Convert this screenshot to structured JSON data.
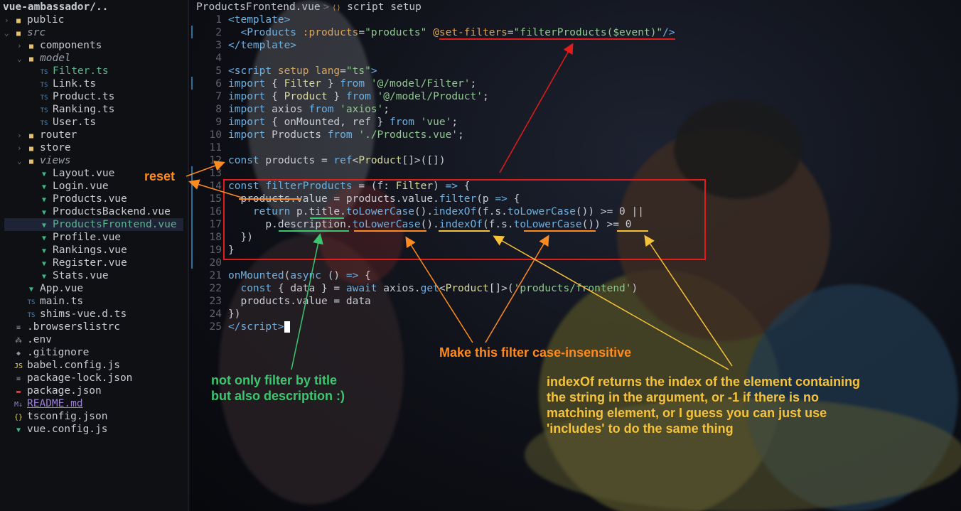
{
  "sidebar": {
    "root": "vue-ambassador/..",
    "items": [
      {
        "label": "public",
        "icon": "folder-icon",
        "depth": 0,
        "arrow": "›",
        "cls": "txt",
        "ic": "ic-folder",
        "glyph": "■"
      },
      {
        "label": "src",
        "icon": "folder-icon",
        "depth": 0,
        "arrow": "⌄",
        "cls": "lbl-muted",
        "ic": "ic-folder",
        "glyph": "■"
      },
      {
        "label": "components",
        "icon": "folder-icon",
        "depth": 1,
        "arrow": "›",
        "cls": "txt",
        "ic": "ic-folder",
        "glyph": "■"
      },
      {
        "label": "model",
        "icon": "folder-icon",
        "depth": 1,
        "arrow": "⌄",
        "cls": "lbl-muted",
        "ic": "ic-folder",
        "glyph": "■"
      },
      {
        "label": "Filter.ts",
        "icon": "typescript-file-icon",
        "depth": 2,
        "arrow": "",
        "cls": "lbl-green",
        "ic": "ic-ts",
        "glyph": "TS"
      },
      {
        "label": "Link.ts",
        "icon": "typescript-file-icon",
        "depth": 2,
        "arrow": "",
        "cls": "txt",
        "ic": "ic-ts",
        "glyph": "TS"
      },
      {
        "label": "Product.ts",
        "icon": "typescript-file-icon",
        "depth": 2,
        "arrow": "",
        "cls": "txt",
        "ic": "ic-ts",
        "glyph": "TS"
      },
      {
        "label": "Ranking.ts",
        "icon": "typescript-file-icon",
        "depth": 2,
        "arrow": "",
        "cls": "txt",
        "ic": "ic-ts",
        "glyph": "TS"
      },
      {
        "label": "User.ts",
        "icon": "typescript-file-icon",
        "depth": 2,
        "arrow": "",
        "cls": "txt",
        "ic": "ic-ts",
        "glyph": "TS"
      },
      {
        "label": "router",
        "icon": "folder-icon",
        "depth": 1,
        "arrow": "›",
        "cls": "txt",
        "ic": "ic-folder",
        "glyph": "■"
      },
      {
        "label": "store",
        "icon": "folder-icon",
        "depth": 1,
        "arrow": "›",
        "cls": "txt",
        "ic": "ic-folder",
        "glyph": "■"
      },
      {
        "label": "views",
        "icon": "folder-icon",
        "depth": 1,
        "arrow": "⌄",
        "cls": "lbl-muted",
        "ic": "ic-folder",
        "glyph": "■"
      },
      {
        "label": "Layout.vue",
        "icon": "vue-file-icon",
        "depth": 2,
        "arrow": "",
        "cls": "txt",
        "ic": "ic-vue",
        "glyph": "▼"
      },
      {
        "label": "Login.vue",
        "icon": "vue-file-icon",
        "depth": 2,
        "arrow": "",
        "cls": "txt",
        "ic": "ic-vue",
        "glyph": "▼"
      },
      {
        "label": "Products.vue",
        "icon": "vue-file-icon",
        "depth": 2,
        "arrow": "",
        "cls": "txt",
        "ic": "ic-vue",
        "glyph": "▼"
      },
      {
        "label": "ProductsBackend.vue",
        "icon": "vue-file-icon",
        "depth": 2,
        "arrow": "",
        "cls": "txt",
        "ic": "ic-vue",
        "glyph": "▼"
      },
      {
        "label": "ProductsFrontend.vue",
        "icon": "vue-file-icon",
        "depth": 2,
        "arrow": "",
        "cls": "lbl-green",
        "ic": "ic-vue",
        "glyph": "▼",
        "selected": true
      },
      {
        "label": "Profile.vue",
        "icon": "vue-file-icon",
        "depth": 2,
        "arrow": "",
        "cls": "txt",
        "ic": "ic-vue",
        "glyph": "▼"
      },
      {
        "label": "Rankings.vue",
        "icon": "vue-file-icon",
        "depth": 2,
        "arrow": "",
        "cls": "txt",
        "ic": "ic-vue",
        "glyph": "▼"
      },
      {
        "label": "Register.vue",
        "icon": "vue-file-icon",
        "depth": 2,
        "arrow": "",
        "cls": "txt",
        "ic": "ic-vue",
        "glyph": "▼"
      },
      {
        "label": "Stats.vue",
        "icon": "vue-file-icon",
        "depth": 2,
        "arrow": "",
        "cls": "txt",
        "ic": "ic-vue",
        "glyph": "▼"
      },
      {
        "label": "App.vue",
        "icon": "vue-file-icon",
        "depth": 1,
        "arrow": "",
        "cls": "txt",
        "ic": "ic-vue",
        "glyph": "▼"
      },
      {
        "label": "main.ts",
        "icon": "typescript-file-icon",
        "depth": 1,
        "arrow": "",
        "cls": "txt",
        "ic": "ic-ts",
        "glyph": "TS"
      },
      {
        "label": "shims-vue.d.ts",
        "icon": "typescript-file-icon",
        "depth": 1,
        "arrow": "",
        "cls": "txt",
        "ic": "ic-ts",
        "glyph": "TS"
      },
      {
        "label": ".browserslistrc",
        "icon": "config-file-icon",
        "depth": 0,
        "arrow": "",
        "cls": "txt",
        "ic": "ic-gen",
        "glyph": "≡"
      },
      {
        "label": ".env",
        "icon": "env-file-icon",
        "depth": 0,
        "arrow": "",
        "cls": "txt",
        "ic": "ic-gen",
        "glyph": "⁂"
      },
      {
        "label": ".gitignore",
        "icon": "git-file-icon",
        "depth": 0,
        "arrow": "",
        "cls": "txt",
        "ic": "ic-gen",
        "glyph": "◆"
      },
      {
        "label": "babel.config.js",
        "icon": "javascript-file-icon",
        "depth": 0,
        "arrow": "",
        "cls": "txt",
        "ic": "ic-js",
        "glyph": "JS"
      },
      {
        "label": "package-lock.json",
        "icon": "json-file-icon",
        "depth": 0,
        "arrow": "",
        "cls": "txt",
        "ic": "ic-gen",
        "glyph": "≡"
      },
      {
        "label": "package.json",
        "icon": "npm-file-icon",
        "depth": 0,
        "arrow": "",
        "cls": "txt",
        "ic": "ic-pkg",
        "glyph": "▬"
      },
      {
        "label": "README.md",
        "icon": "markdown-file-icon",
        "depth": 0,
        "arrow": "",
        "cls": "readme",
        "ic": "ic-md",
        "glyph": "M↓"
      },
      {
        "label": "tsconfig.json",
        "icon": "json-file-icon",
        "depth": 0,
        "arrow": "",
        "cls": "txt",
        "ic": "ic-json",
        "glyph": "{}"
      },
      {
        "label": "vue.config.js",
        "icon": "vue-file-icon",
        "depth": 0,
        "arrow": "",
        "cls": "txt",
        "ic": "ic-vue",
        "glyph": "▼"
      }
    ]
  },
  "breadcrumb": {
    "file": "ProductsFrontend.vue",
    "separator": ">",
    "section_icon": "code-icon",
    "section": "script setup"
  },
  "code": [
    {
      "n": "1",
      "tokens": [
        [
          "tag",
          "<template>"
        ]
      ]
    },
    {
      "n": "2",
      "tokens": [
        [
          "txt",
          "  "
        ],
        [
          "tag",
          "<Products"
        ],
        [
          "txt",
          " "
        ],
        [
          "attr",
          ":products"
        ],
        [
          "pun",
          "="
        ],
        [
          "str",
          "\"products\""
        ],
        [
          "txt",
          " "
        ],
        [
          "attr",
          "@set-filters"
        ],
        [
          "pun",
          "="
        ],
        [
          "str",
          "\"filterProducts($event)\""
        ],
        [
          "tag",
          "/>"
        ]
      ]
    },
    {
      "n": "3",
      "tokens": [
        [
          "tag",
          "</template>"
        ]
      ]
    },
    {
      "n": "4",
      "tokens": []
    },
    {
      "n": "5",
      "tokens": [
        [
          "tag",
          "<script"
        ],
        [
          "txt",
          " "
        ],
        [
          "attr",
          "setup"
        ],
        [
          "txt",
          " "
        ],
        [
          "attr",
          "lang"
        ],
        [
          "pun",
          "="
        ],
        [
          "str",
          "\"ts\""
        ],
        [
          "tag",
          ">"
        ]
      ]
    },
    {
      "n": "6",
      "tokens": [
        [
          "kw",
          "import"
        ],
        [
          "txt",
          " { "
        ],
        [
          "typ",
          "Filter"
        ],
        [
          "txt",
          " } "
        ],
        [
          "kw",
          "from"
        ],
        [
          "txt",
          " "
        ],
        [
          "str",
          "'@/model/Filter'"
        ],
        [
          "pun",
          ";"
        ]
      ]
    },
    {
      "n": "7",
      "tokens": [
        [
          "kw",
          "import"
        ],
        [
          "txt",
          " { "
        ],
        [
          "typ",
          "Product"
        ],
        [
          "txt",
          " } "
        ],
        [
          "kw",
          "from"
        ],
        [
          "txt",
          " "
        ],
        [
          "str",
          "'@/model/Product'"
        ],
        [
          "pun",
          ";"
        ]
      ]
    },
    {
      "n": "8",
      "tokens": [
        [
          "kw",
          "import"
        ],
        [
          "txt",
          " axios "
        ],
        [
          "kw",
          "from"
        ],
        [
          "txt",
          " "
        ],
        [
          "str",
          "'axios'"
        ],
        [
          "pun",
          ";"
        ]
      ]
    },
    {
      "n": "9",
      "tokens": [
        [
          "kw",
          "import"
        ],
        [
          "txt",
          " { onMounted, ref } "
        ],
        [
          "kw",
          "from"
        ],
        [
          "txt",
          " "
        ],
        [
          "str",
          "'vue'"
        ],
        [
          "pun",
          ";"
        ]
      ]
    },
    {
      "n": "10",
      "tokens": [
        [
          "kw",
          "import"
        ],
        [
          "txt",
          " Products "
        ],
        [
          "kw",
          "from"
        ],
        [
          "txt",
          " "
        ],
        [
          "str",
          "'./Products.vue'"
        ],
        [
          "pun",
          ";"
        ]
      ]
    },
    {
      "n": "11",
      "tokens": []
    },
    {
      "n": "12",
      "tokens": [
        [
          "kw",
          "const"
        ],
        [
          "txt",
          " products = "
        ],
        [
          "fn",
          "ref"
        ],
        [
          "pun",
          "<"
        ],
        [
          "typ",
          "Product"
        ],
        [
          "pun",
          "[]>([])"
        ]
      ]
    },
    {
      "n": "13",
      "tokens": []
    },
    {
      "n": "14",
      "tokens": [
        [
          "kw",
          "const"
        ],
        [
          "txt",
          " "
        ],
        [
          "fn",
          "filterProducts"
        ],
        [
          "txt",
          " = (f: "
        ],
        [
          "typ",
          "Filter"
        ],
        [
          "txt",
          ") "
        ],
        [
          "kw",
          "=>"
        ],
        [
          "txt",
          " {"
        ]
      ]
    },
    {
      "n": "15",
      "tokens": [
        [
          "txt",
          "  products.value = products.value."
        ],
        [
          "fn",
          "filter"
        ],
        [
          "txt",
          "(p "
        ],
        [
          "kw",
          "=>"
        ],
        [
          "txt",
          " {"
        ]
      ]
    },
    {
      "n": "16",
      "tokens": [
        [
          "txt",
          "    "
        ],
        [
          "kw",
          "return"
        ],
        [
          "txt",
          " p.title."
        ],
        [
          "fn",
          "toLowerCase"
        ],
        [
          "txt",
          "()."
        ],
        [
          "fn",
          "indexOf"
        ],
        [
          "txt",
          "(f.s."
        ],
        [
          "fn",
          "toLowerCase"
        ],
        [
          "txt",
          "()) >= 0 ||"
        ]
      ]
    },
    {
      "n": "17",
      "tokens": [
        [
          "txt",
          "      p.description."
        ],
        [
          "fn",
          "toLowerCase"
        ],
        [
          "txt",
          "()."
        ],
        [
          "fn",
          "indexOf"
        ],
        [
          "txt",
          "(f.s."
        ],
        [
          "fn",
          "toLowerCase"
        ],
        [
          "txt",
          "()) >= 0"
        ]
      ]
    },
    {
      "n": "18",
      "tokens": [
        [
          "txt",
          "  })"
        ]
      ]
    },
    {
      "n": "19",
      "tokens": [
        [
          "txt",
          "}"
        ]
      ]
    },
    {
      "n": "20",
      "tokens": []
    },
    {
      "n": "21",
      "tokens": [
        [
          "fn",
          "onMounted"
        ],
        [
          "txt",
          "("
        ],
        [
          "kw",
          "async"
        ],
        [
          "txt",
          " () "
        ],
        [
          "kw",
          "=>"
        ],
        [
          "txt",
          " {"
        ]
      ]
    },
    {
      "n": "22",
      "tokens": [
        [
          "txt",
          "  "
        ],
        [
          "kw",
          "const"
        ],
        [
          "txt",
          " { data } = "
        ],
        [
          "kw",
          "await"
        ],
        [
          "txt",
          " axios."
        ],
        [
          "fn",
          "get"
        ],
        [
          "pun",
          "<"
        ],
        [
          "typ",
          "Product"
        ],
        [
          "pun",
          "[]>"
        ],
        [
          "txt",
          "("
        ],
        [
          "str",
          "'products/frontend'"
        ],
        [
          "txt",
          ")"
        ]
      ]
    },
    {
      "n": "23",
      "tokens": [
        [
          "txt",
          "  products.value = data"
        ]
      ]
    },
    {
      "n": "24",
      "tokens": [
        [
          "txt",
          "})"
        ]
      ]
    },
    {
      "n": "25",
      "tokens": [
        [
          "tag",
          "</script"
        ],
        [
          "tag",
          ">"
        ]
      ]
    }
  ],
  "annotations": {
    "reset": "reset",
    "case_insensitive": "Make this filter case-insensitive",
    "description_note": "not only filter by title\nbut also description :)",
    "indexof_note": "indexOf returns the index of the element containing\nthe string in the argument, or -1 if there is no\nmatching element, or I guess you can just use\n'includes' to do the same thing"
  },
  "colors": {
    "red": "#e31b1b",
    "orange": "#ff8a1e",
    "green": "#3ac770",
    "yellow": "#f5c23a"
  }
}
